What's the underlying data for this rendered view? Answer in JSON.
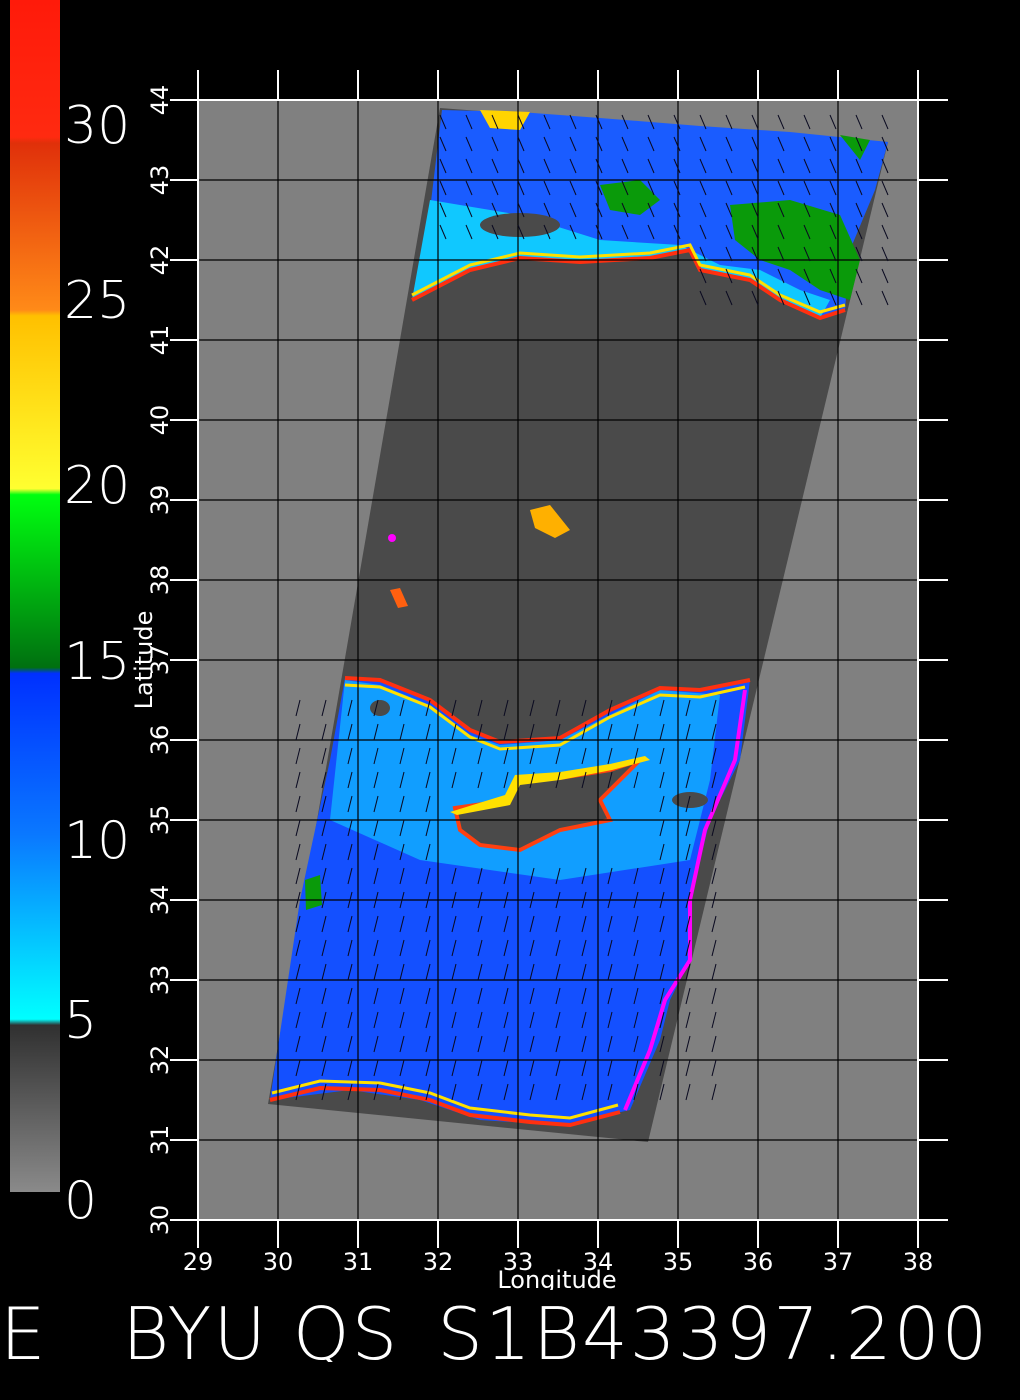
{
  "colorbar": {
    "labels": [
      "30",
      "25",
      "20",
      "15",
      "10",
      "5",
      "0"
    ],
    "colors": {
      "red": "#ff1a0a",
      "orange": "#ff7a10",
      "yellow": "#ffd400",
      "green": "#0a9a0a",
      "blue": "#1a5cff",
      "cyan": "#10d8ff",
      "gray": "#8a8a8a"
    }
  },
  "map": {
    "x_axis_label": "Longitude",
    "y_axis_label": "Latitude",
    "x_ticks": [
      "29",
      "30",
      "31",
      "32",
      "33",
      "34",
      "35",
      "36",
      "37",
      "38"
    ],
    "y_ticks": [
      "30",
      "31",
      "32",
      "33",
      "34",
      "35",
      "36",
      "37",
      "38",
      "39",
      "40",
      "41",
      "42",
      "43",
      "44"
    ],
    "lon_range": [
      29,
      38
    ],
    "lat_range": [
      30,
      44
    ],
    "colors": {
      "background": "#808080",
      "land": "#4a4a4a",
      "ocean": "#1450ff",
      "grid": "#000000"
    }
  },
  "footer": {
    "title": "E   BYU QS_S1B43397.200"
  }
}
